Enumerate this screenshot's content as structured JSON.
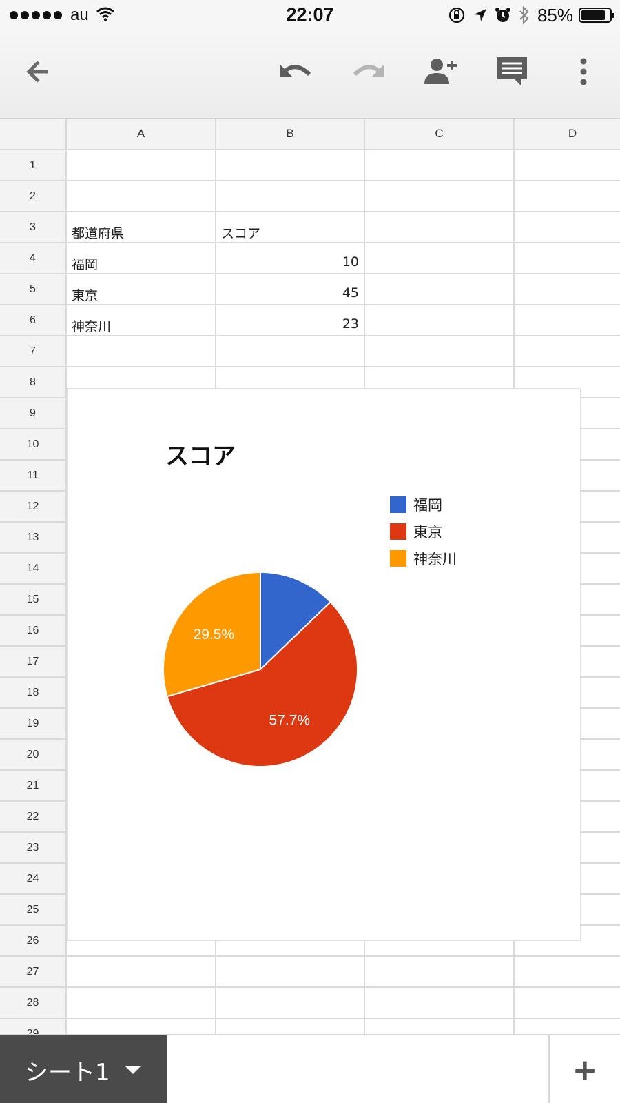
{
  "status_bar": {
    "carrier": "au",
    "time": "22:07",
    "battery_text": "85%",
    "battery_level": 0.85,
    "icons": [
      "signal-dots-icon",
      "wifi-icon",
      "rotation-lock-icon",
      "location-arrow-icon",
      "alarm-icon",
      "bluetooth-icon",
      "battery-icon"
    ]
  },
  "toolbar": {
    "icons": [
      "back-arrow-icon",
      "undo-icon",
      "redo-icon",
      "add-person-icon",
      "comment-icon",
      "more-vert-icon"
    ]
  },
  "grid": {
    "columns": [
      "A",
      "B",
      "C",
      "D"
    ],
    "rows": [
      {
        "n": "1",
        "a": "",
        "b": ""
      },
      {
        "n": "2",
        "a": "",
        "b": ""
      },
      {
        "n": "3",
        "a": "都道府県",
        "b": "スコア"
      },
      {
        "n": "4",
        "a": "福岡",
        "b": "10"
      },
      {
        "n": "5",
        "a": "東京",
        "b": "45"
      },
      {
        "n": "6",
        "a": "神奈川",
        "b": "23"
      },
      {
        "n": "7",
        "a": "",
        "b": ""
      },
      {
        "n": "8",
        "a": "",
        "b": ""
      },
      {
        "n": "9",
        "a": "",
        "b": ""
      },
      {
        "n": "10",
        "a": "",
        "b": ""
      },
      {
        "n": "11",
        "a": "",
        "b": ""
      },
      {
        "n": "12",
        "a": "",
        "b": ""
      },
      {
        "n": "13",
        "a": "",
        "b": ""
      },
      {
        "n": "14",
        "a": "",
        "b": ""
      },
      {
        "n": "15",
        "a": "",
        "b": ""
      },
      {
        "n": "16",
        "a": "",
        "b": ""
      },
      {
        "n": "17",
        "a": "",
        "b": ""
      },
      {
        "n": "18",
        "a": "",
        "b": ""
      },
      {
        "n": "19",
        "a": "",
        "b": ""
      },
      {
        "n": "20",
        "a": "",
        "b": ""
      },
      {
        "n": "21",
        "a": "",
        "b": ""
      },
      {
        "n": "22",
        "a": "",
        "b": ""
      },
      {
        "n": "23",
        "a": "",
        "b": ""
      },
      {
        "n": "24",
        "a": "",
        "b": ""
      },
      {
        "n": "25",
        "a": "",
        "b": ""
      },
      {
        "n": "26",
        "a": "",
        "b": ""
      },
      {
        "n": "27",
        "a": "",
        "b": ""
      },
      {
        "n": "28",
        "a": "",
        "b": ""
      },
      {
        "n": "29",
        "a": "",
        "b": ""
      }
    ]
  },
  "chart_data": {
    "type": "pie",
    "title": "スコア",
    "categories": [
      "福岡",
      "東京",
      "神奈川"
    ],
    "values": [
      10,
      45,
      23
    ],
    "colors": [
      "#3366cc",
      "#dc3912",
      "#ff9900"
    ],
    "slice_labels": [
      "",
      "57.7%",
      "29.5%"
    ],
    "legend_position": "right"
  },
  "bottom_bar": {
    "sheet_tab": "シート1",
    "add_sheet": "+"
  }
}
